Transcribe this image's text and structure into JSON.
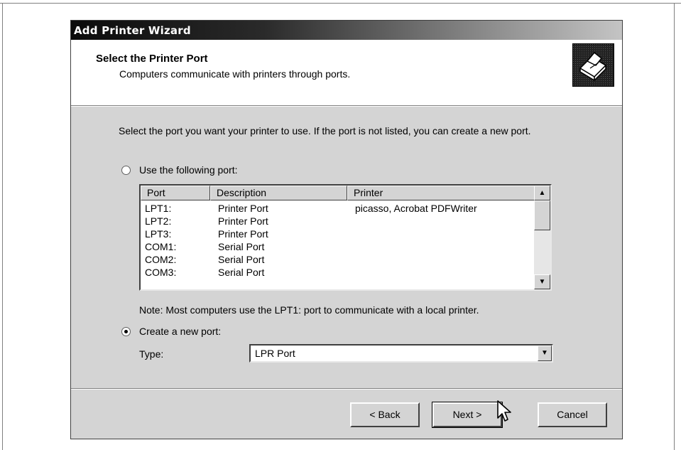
{
  "window": {
    "title": "Add Printer Wizard"
  },
  "header": {
    "title": "Select the Printer Port",
    "subtitle": "Computers communicate with printers through ports.",
    "icon": "printer-icon"
  },
  "intro_text": "Select the port you want your printer to use.  If the port is not listed, you can create a new port.",
  "existing_port": {
    "label": "Use the following port:",
    "selected": false,
    "columns": [
      "Port",
      "Description",
      "Printer"
    ],
    "rows": [
      {
        "port": "LPT1:",
        "description": "Printer Port",
        "printer": "picasso, Acrobat PDFWriter"
      },
      {
        "port": "LPT2:",
        "description": "Printer Port",
        "printer": ""
      },
      {
        "port": "LPT3:",
        "description": "Printer Port",
        "printer": ""
      },
      {
        "port": "COM1:",
        "description": "Serial Port",
        "printer": ""
      },
      {
        "port": "COM2:",
        "description": "Serial Port",
        "printer": ""
      },
      {
        "port": "COM3:",
        "description": "Serial Port",
        "printer": ""
      }
    ],
    "note": "Note: Most computers use the LPT1: port to communicate with a local printer."
  },
  "new_port": {
    "label": "Create a new port:",
    "selected": true,
    "type_label": "Type:",
    "type_value": "LPR Port"
  },
  "buttons": {
    "back": "< Back",
    "next": "Next >",
    "cancel": "Cancel"
  }
}
